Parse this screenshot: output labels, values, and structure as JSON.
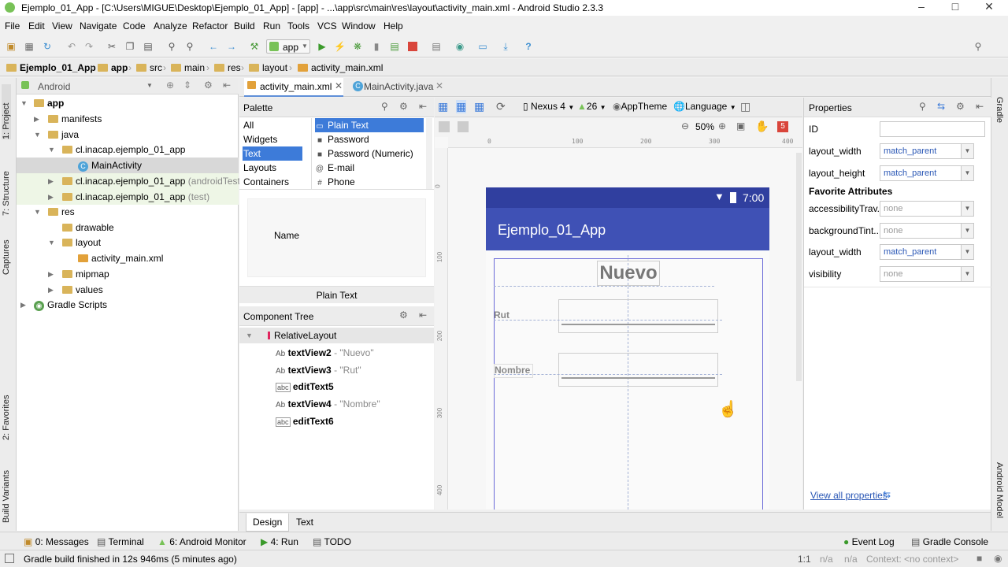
{
  "window": {
    "title": "Ejemplo_01_App - [C:\\Users\\MIGUE\\Desktop\\Ejemplo_01_App] - [app] - ...\\app\\src\\main\\res\\layout\\activity_main.xml - Android Studio 2.3.3"
  },
  "menu": [
    "File",
    "Edit",
    "View",
    "Navigate",
    "Code",
    "Analyze",
    "Refactor",
    "Build",
    "Run",
    "Tools",
    "VCS",
    "Window",
    "Help"
  ],
  "toolbar": {
    "run_config": "app"
  },
  "breadcrumb": [
    "Ejemplo_01_App",
    "app",
    "src",
    "main",
    "res",
    "layout",
    "activity_main.xml"
  ],
  "left_tool_tabs": [
    "1: Project",
    "7: Structure",
    "Captures",
    "2: Favorites",
    "Build Variants"
  ],
  "right_tool_tabs": [
    "Gradle",
    "Android Model"
  ],
  "project": {
    "view_mode": "Android",
    "tree": [
      {
        "label": "app",
        "hint": ""
      },
      {
        "label": "manifests",
        "hint": ""
      },
      {
        "label": "java",
        "hint": ""
      },
      {
        "label": "cl.inacap.ejemplo_01_app",
        "hint": ""
      },
      {
        "label": "MainActivity",
        "hint": ""
      },
      {
        "label": "cl.inacap.ejemplo_01_app",
        "hint": "(androidTest)"
      },
      {
        "label": "cl.inacap.ejemplo_01_app",
        "hint": "(test)"
      },
      {
        "label": "res",
        "hint": ""
      },
      {
        "label": "drawable",
        "hint": ""
      },
      {
        "label": "layout",
        "hint": ""
      },
      {
        "label": "activity_main.xml",
        "hint": ""
      },
      {
        "label": "mipmap",
        "hint": ""
      },
      {
        "label": "values",
        "hint": ""
      },
      {
        "label": "Gradle Scripts",
        "hint": ""
      }
    ]
  },
  "editor_tabs": [
    "activity_main.xml",
    "MainActivity.java"
  ],
  "palette": {
    "title": "Palette",
    "categories": [
      "All",
      "Widgets",
      "Text",
      "Layouts",
      "Containers"
    ],
    "selected_category": "Text",
    "items": [
      {
        "icon": "text-field-icon",
        "label": "Plain Text"
      },
      {
        "icon": "lock-icon",
        "label": "Password"
      },
      {
        "icon": "lock-icon",
        "label": "Password (Numeric)"
      },
      {
        "icon": "at-icon",
        "label": "E-mail"
      },
      {
        "icon": "hash-icon",
        "label": "Phone"
      }
    ],
    "preview_text": "Name",
    "preview_caption": "Plain Text"
  },
  "component_tree": {
    "title": "Component Tree",
    "root": "RelativeLayout",
    "items": [
      {
        "icon": "Ab",
        "id": "textView2",
        "text": "- \"Nuevo\""
      },
      {
        "icon": "Ab",
        "id": "textView3",
        "text": "- \"Rut\""
      },
      {
        "icon": "abc",
        "id": "editText5",
        "text": ""
      },
      {
        "icon": "Ab",
        "id": "textView4",
        "text": "- \"Nombre\""
      },
      {
        "icon": "abc",
        "id": "editText6",
        "text": ""
      }
    ]
  },
  "designer": {
    "device": "Nexus 4",
    "api": "26",
    "theme": "AppTheme",
    "language": "Language",
    "zoom": "50%",
    "warnings": "5",
    "ruler_h": [
      "0",
      "100",
      "200",
      "300",
      "400"
    ],
    "ruler_v": [
      "0",
      "100",
      "200",
      "300",
      "400"
    ],
    "status_time": "7:00",
    "app_title": "Ejemplo_01_App",
    "texts": {
      "nuevo": "Nuevo",
      "rut": "Rut",
      "nombre": "Nombre"
    }
  },
  "properties": {
    "title": "Properties",
    "rows": [
      {
        "name": "ID",
        "value": ""
      },
      {
        "name": "layout_width",
        "value": "match_parent"
      },
      {
        "name": "layout_height",
        "value": "match_parent"
      }
    ],
    "favorites_title": "Favorite Attributes",
    "favorites": [
      {
        "name": "accessibilityTrav...",
        "value": "none"
      },
      {
        "name": "backgroundTint...",
        "value": "none"
      },
      {
        "name": "layout_width",
        "value": "match_parent"
      },
      {
        "name": "visibility",
        "value": "none"
      }
    ],
    "view_all": "View all properties"
  },
  "bottom_tabs": [
    "Design",
    "Text"
  ],
  "tool_windows": [
    "0: Messages",
    "Terminal",
    "6: Android Monitor",
    "4: Run",
    "TODO"
  ],
  "tool_windows_right": [
    "Event Log",
    "Gradle Console"
  ],
  "status": {
    "message": "Gradle build finished in 12s 946ms (5 minutes ago)",
    "position": "1:1",
    "na1": "n/a",
    "na2": "n/a",
    "context": "Context: <no context>"
  }
}
